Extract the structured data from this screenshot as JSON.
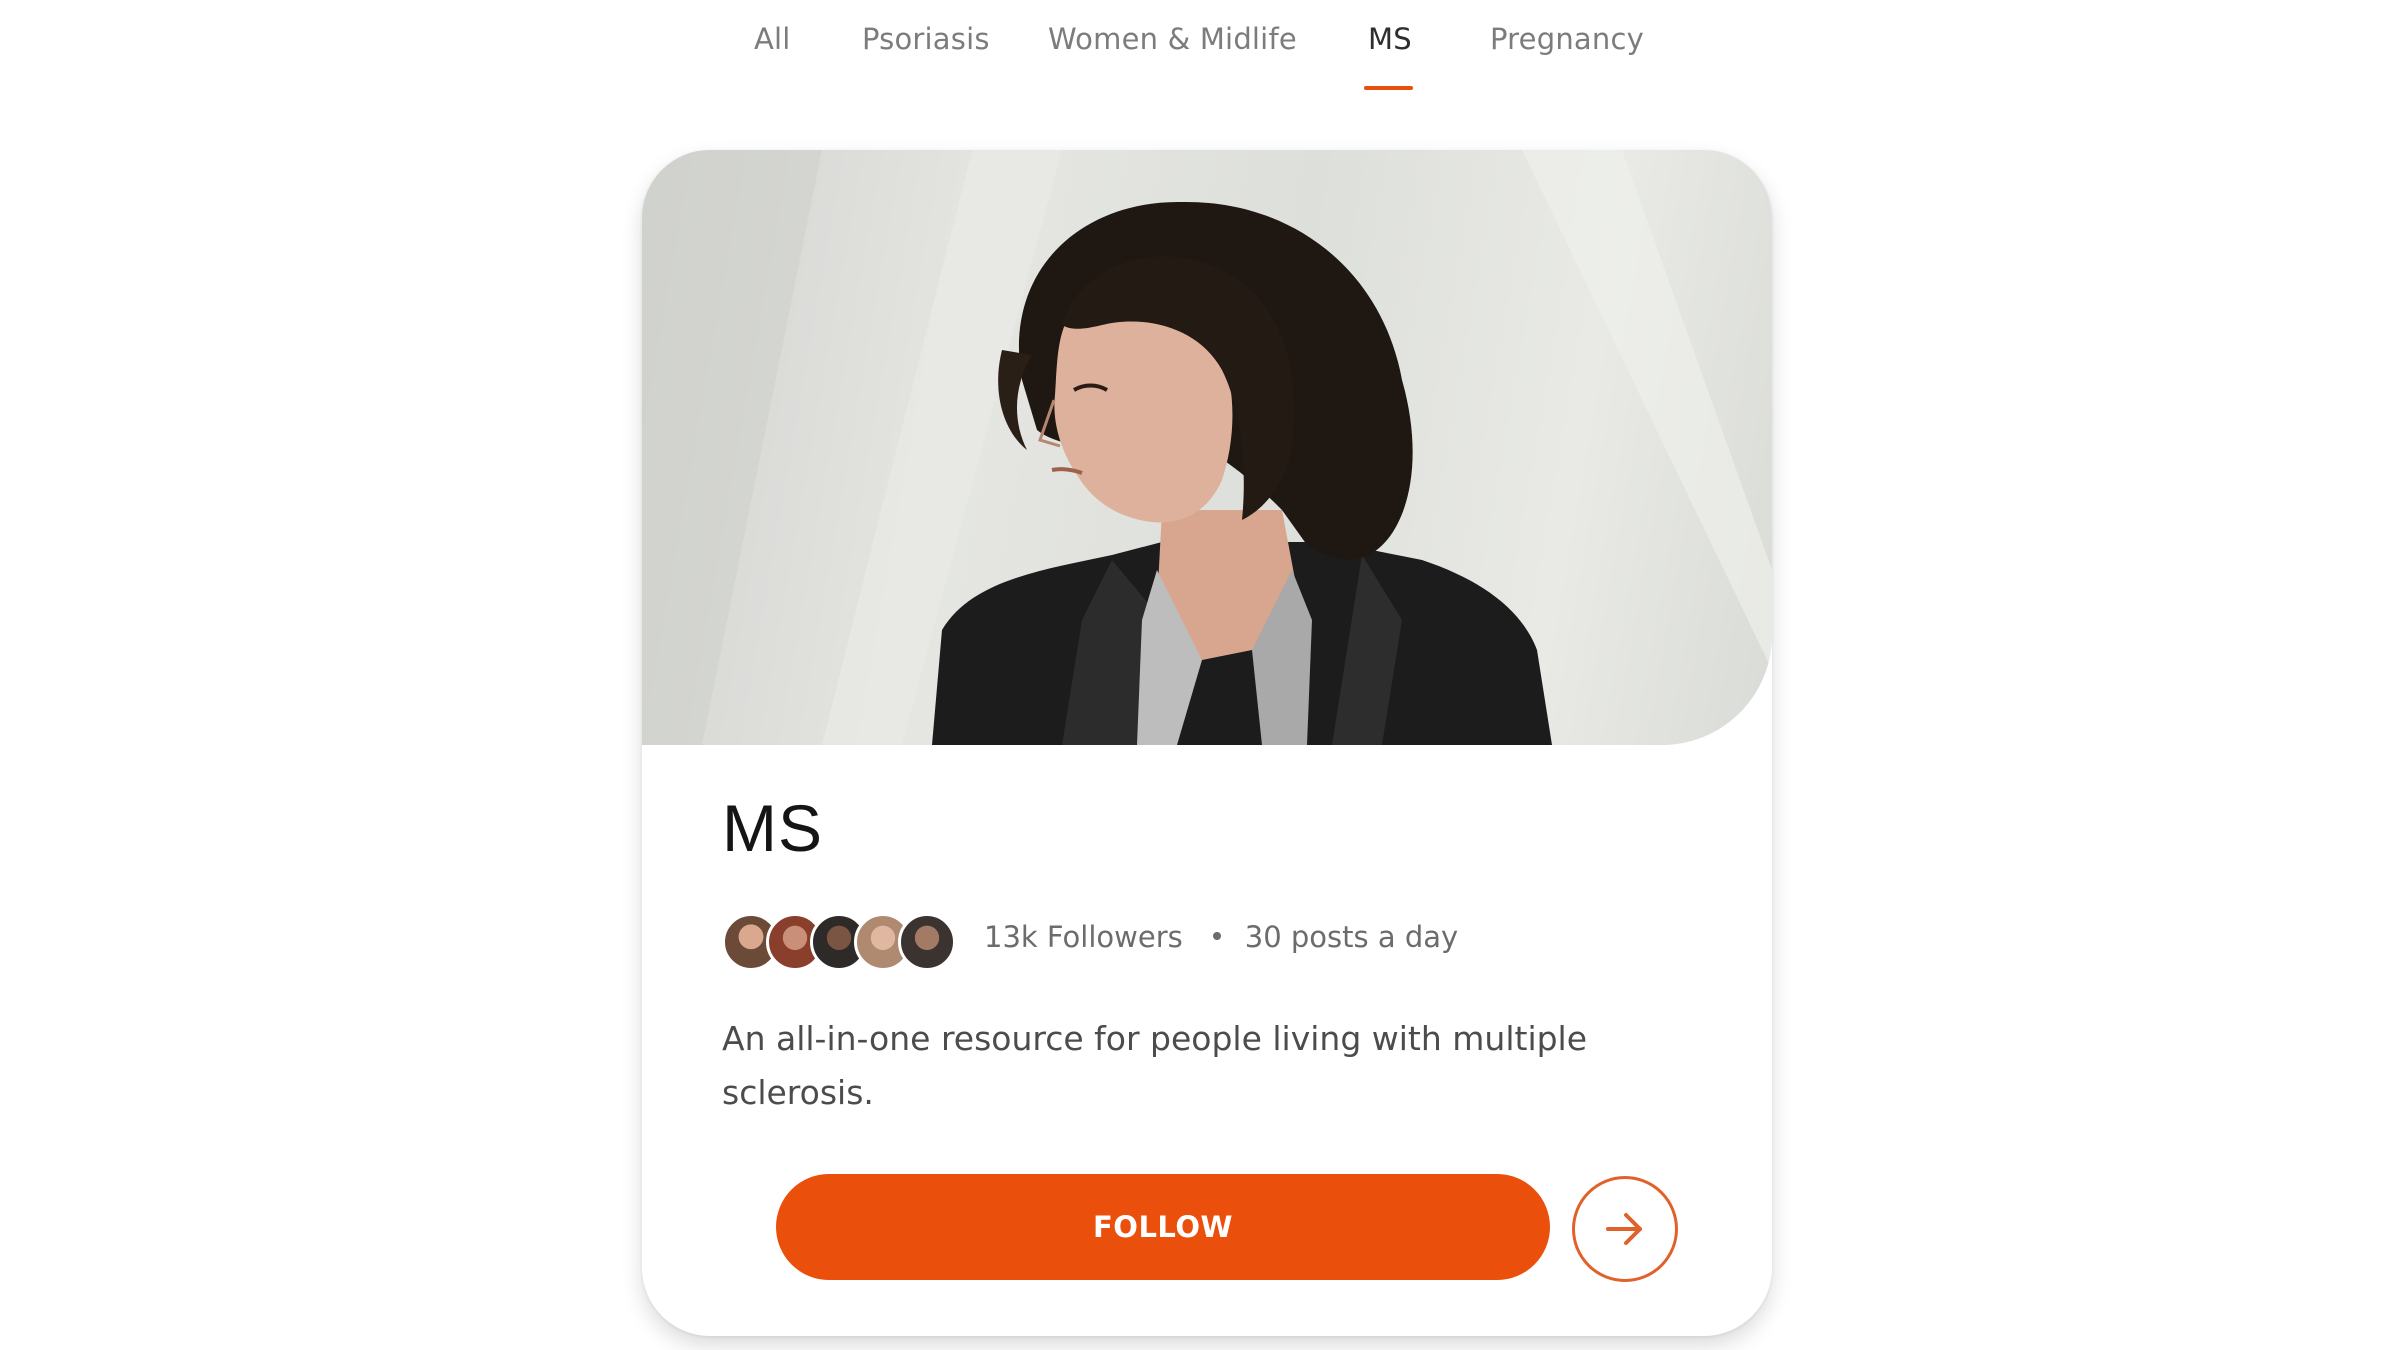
{
  "tabs": [
    {
      "label": "All"
    },
    {
      "label": "Psoriasis"
    },
    {
      "label": "Women & Midlife"
    },
    {
      "label": "MS"
    },
    {
      "label": "Pregnancy"
    }
  ],
  "active_tab": "MS",
  "card": {
    "title": "MS",
    "followers": "13k Followers",
    "activity": "30 posts a day",
    "description": "An all-in-one resource for people living with multiple sclerosis.",
    "follow_label": "FOLLOW",
    "hero_image": "woman-with-curly-hair-portrait",
    "avatar_count": 5
  },
  "colors": {
    "accent": "#EA4F0C",
    "tab_active": "#2E2E2E",
    "tab_inactive": "#7C7C7C"
  },
  "icons": {
    "arrow": "arrow-right-icon"
  }
}
